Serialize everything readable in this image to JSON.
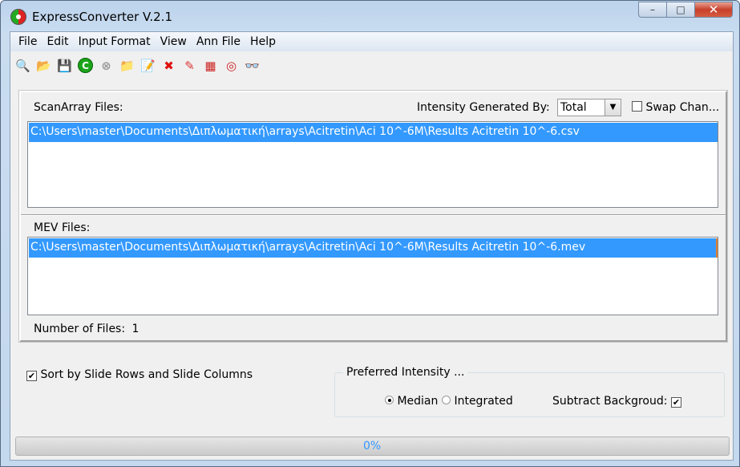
{
  "window": {
    "title": "ExpressConverter V.2.1",
    "controls": {
      "minimize": "–",
      "maximize": "□",
      "close": "✕"
    }
  },
  "menu": [
    "File",
    "Edit",
    "Input Format",
    "View",
    "Ann File",
    "Help"
  ],
  "toolbar": [
    {
      "icon": "find-file",
      "glyph": "🔍",
      "color": "#c9a640"
    },
    {
      "icon": "open-folder",
      "glyph": "📂",
      "color": "#888"
    },
    {
      "icon": "save",
      "glyph": "💾",
      "color": "#555"
    },
    {
      "icon": "convert",
      "glyph": "C",
      "color": "#1aa51a"
    },
    {
      "icon": "stop",
      "glyph": "⊗",
      "color": "#999"
    },
    {
      "icon": "export-folder",
      "glyph": "📁",
      "color": "#c9b040"
    },
    {
      "icon": "edit-document",
      "glyph": "📝",
      "color": "#2244aa"
    },
    {
      "icon": "delete",
      "glyph": "✖",
      "color": "#e01010"
    },
    {
      "icon": "eraser",
      "glyph": "✎",
      "color": "#d33"
    },
    {
      "icon": "grid-layout",
      "glyph": "▦",
      "color": "#c22"
    },
    {
      "icon": "help-lifebuoy",
      "glyph": "◎",
      "color": "#c22"
    },
    {
      "icon": "binoculars",
      "glyph": "👓",
      "color": "#1a3f99"
    }
  ],
  "scanarray": {
    "label": "ScanArray Files:",
    "intensity_label": "Intensity Generated By:",
    "intensity_value": "Total",
    "swap_label": "Swap Chan...",
    "swap_checked": false,
    "files": [
      "C:\\Users\\master\\Documents\\Διπλωματική\\arrays\\Acitretin\\Aci 10^-6M\\Results Acitretin 10^-6.csv"
    ]
  },
  "mev": {
    "label": "MEV Files:",
    "files": [
      "C:\\Users\\master\\Documents\\Διπλωματική\\arrays\\Acitretin\\Aci 10^-6M\\Results Acitretin 10^-6.mev"
    ]
  },
  "count": {
    "label": "Number of Files:",
    "value": "1"
  },
  "sort": {
    "label": "Sort by Slide Rows and Slide Columns",
    "checked": true
  },
  "preferred": {
    "legend": "Preferred Intensity ...",
    "median": "Median",
    "integrated": "Integrated",
    "selected": "Median",
    "subtract_label": "Subtract Backgroud:",
    "subtract_checked": true
  },
  "progress": {
    "text": "0%",
    "value": 0,
    "text_color": "#3399ff"
  },
  "colors": {
    "selection": "#3399ff"
  }
}
